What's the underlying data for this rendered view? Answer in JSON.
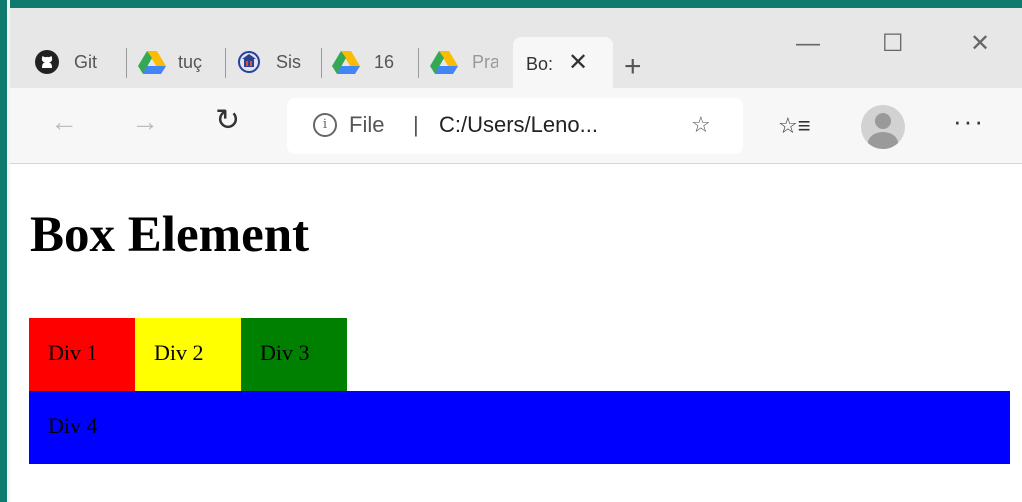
{
  "browser": {
    "tabs": [
      {
        "label": "Git",
        "icon": "github-icon"
      },
      {
        "label": "tuç",
        "icon": "google-drive-icon"
      },
      {
        "label": "Sis",
        "icon": "university-logo-icon"
      },
      {
        "label": "16",
        "icon": "google-drive-icon"
      },
      {
        "label": "Pra",
        "icon": "google-drive-icon"
      }
    ],
    "active_tab": {
      "label": "Bo:",
      "close": "✕"
    },
    "new_tab": "+",
    "window_controls": {
      "minimize": "—",
      "maximize": "☐",
      "close": "✕"
    },
    "nav": {
      "back": "←",
      "forward": "→",
      "refresh": "↻"
    },
    "address": {
      "scheme_label": "File",
      "separator": "|",
      "url": "C:/Users/Leno..."
    },
    "favorites_glyph": "☆≡",
    "more": "···"
  },
  "page": {
    "heading": "Box Element",
    "boxes": [
      {
        "label": "Div 1",
        "color": "#ff0000"
      },
      {
        "label": "Div 2",
        "color": "#ffff00"
      },
      {
        "label": "Div 3",
        "color": "#008000"
      },
      {
        "label": "Div 4",
        "color": "#0000ff"
      }
    ]
  }
}
